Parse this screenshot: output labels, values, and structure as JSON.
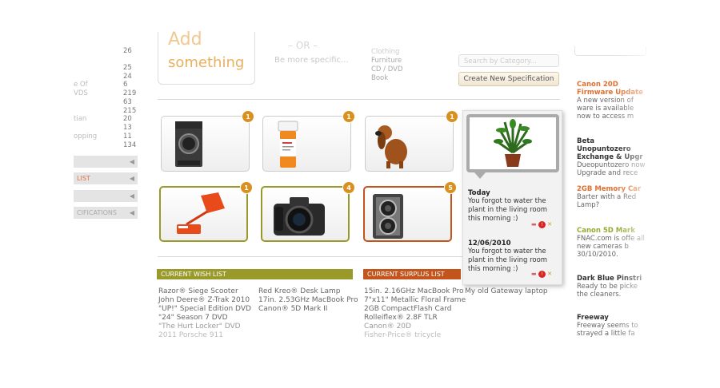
{
  "sidebar": {
    "categories": [
      {
        "name": "",
        "count": "26"
      },
      {
        "name": "",
        "count": "25"
      },
      {
        "name": "",
        "count": "24"
      },
      {
        "name": "e Of",
        "count": "6"
      },
      {
        "name": "VDS",
        "count": "219"
      },
      {
        "name": "",
        "count": "63"
      },
      {
        "name": "",
        "count": "215"
      },
      {
        "name": "tian",
        "count": "20"
      },
      {
        "name": "",
        "count": "13"
      },
      {
        "name": "opping",
        "count": "11"
      },
      {
        "name": "",
        "count": "134"
      }
    ],
    "tabs": [
      {
        "label": ""
      },
      {
        "label": "LIST"
      },
      {
        "label": ""
      },
      {
        "label": "CIFICATIONS"
      }
    ]
  },
  "header": {
    "add_title": "Add",
    "add_sub": "something",
    "dash": "– OR –",
    "spec_text": "Be more specific...",
    "categories": [
      "Clothing",
      "Furniture",
      "CD / DVD",
      "Book"
    ],
    "search_placeholder": "Search by Category...",
    "create_button": "Create New Specification"
  },
  "items": [
    {
      "badge": "1",
      "icon": "washing-machine"
    },
    {
      "badge": "1",
      "icon": "pill-bottle"
    },
    {
      "badge": "1",
      "icon": "dog"
    },
    {
      "badge": "1",
      "icon": "potted-plant"
    },
    {
      "badge": "1",
      "icon": "desk-lamp"
    },
    {
      "badge": "4",
      "icon": "dslr-camera"
    },
    {
      "badge": "5",
      "icon": "tlr-camera"
    }
  ],
  "wish_list": {
    "header": "CURRENT WISH LIST",
    "col1": [
      "Razor® Siege Scooter",
      "John Deere® Z-Trak 2010",
      "\"UP!\" Special Edition DVD",
      "\"24\" Season 7 DVD",
      "\"The Hurt Locker\" DVD",
      "2011 Porsche 911"
    ],
    "col2": [
      "Red Kreo® Desk Lamp",
      "17in. 2.53GHz MacBook Pro",
      "Canon® 5D Mark II"
    ]
  },
  "surplus_list": {
    "header": "CURRENT SURPLUS LIST",
    "col1": [
      "15in. 2.16GHz MacBook Pro",
      "7\"x11\" Metallic Floral Frame",
      "2GB CompactFlash Card",
      "Rolleiflex® 2.8F TLR",
      "Canon® 20D",
      "Fisher-Price® tricycle"
    ],
    "col2": [
      "My old Gateway laptop"
    ]
  },
  "popup": {
    "entries": [
      {
        "title": "Today",
        "body": "You forgot to water the plant in the living room this morning :)"
      },
      {
        "title": "12/06/2010",
        "body": "You forgot to water the plant in the living room this morning :)"
      }
    ]
  },
  "news": [
    {
      "title": "Canon 20D Firmware Update",
      "body": "A new version of ware is available now to access m",
      "color": "#e07030"
    },
    {
      "title": "Beta Unopuntozero Exchange & Upgr",
      "body": "Dueopuntozero now Upgrade and rece",
      "color": "#333333"
    },
    {
      "title": "2GB Memory Car",
      "body": "Barter with a Red Lamp?",
      "color": "#e07030"
    },
    {
      "title": "Canon 5D Mark",
      "body": "FNAC.com is offe all new cameras b 30/10/2010.",
      "color": "#9aa830"
    },
    {
      "title": "Dark Blue Pinstri",
      "body": "Ready to be picke the cleaners.",
      "color": "#333333"
    },
    {
      "title": "Freeway",
      "body": "Freeway seems to strayed a little fa",
      "color": "#333333"
    }
  ],
  "colors": {
    "orange": "#d9901e",
    "olive": "#9a9a2a",
    "rust": "#c2541c"
  }
}
